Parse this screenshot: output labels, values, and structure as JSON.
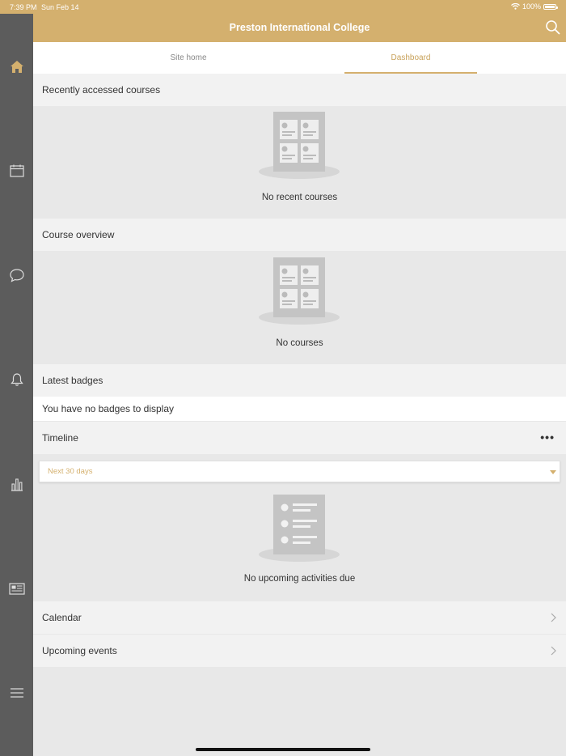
{
  "status": {
    "time": "7:39 PM",
    "date": "Sun Feb 14",
    "battery": "100%"
  },
  "header": {
    "title": "Preston International College"
  },
  "tabs": [
    {
      "label": "Site home"
    },
    {
      "label": "Dashboard"
    }
  ],
  "recent": {
    "title": "Recently accessed courses",
    "empty": "No recent courses"
  },
  "overview": {
    "title": "Course overview",
    "empty": "No courses"
  },
  "badges": {
    "title": "Latest badges",
    "empty": "You have no badges to display"
  },
  "timeline": {
    "title": "Timeline",
    "filter": "Next 30 days",
    "empty": "No upcoming activities due"
  },
  "links": [
    {
      "label": "Calendar"
    },
    {
      "label": "Upcoming events"
    }
  ],
  "sidebar": [
    "home-icon",
    "calendar-icon",
    "messages-icon",
    "notifications-icon",
    "grades-icon",
    "news-icon",
    "menu-icon"
  ],
  "colors": {
    "accent": "#d4b06e",
    "sidebar": "#5c5c5c"
  }
}
